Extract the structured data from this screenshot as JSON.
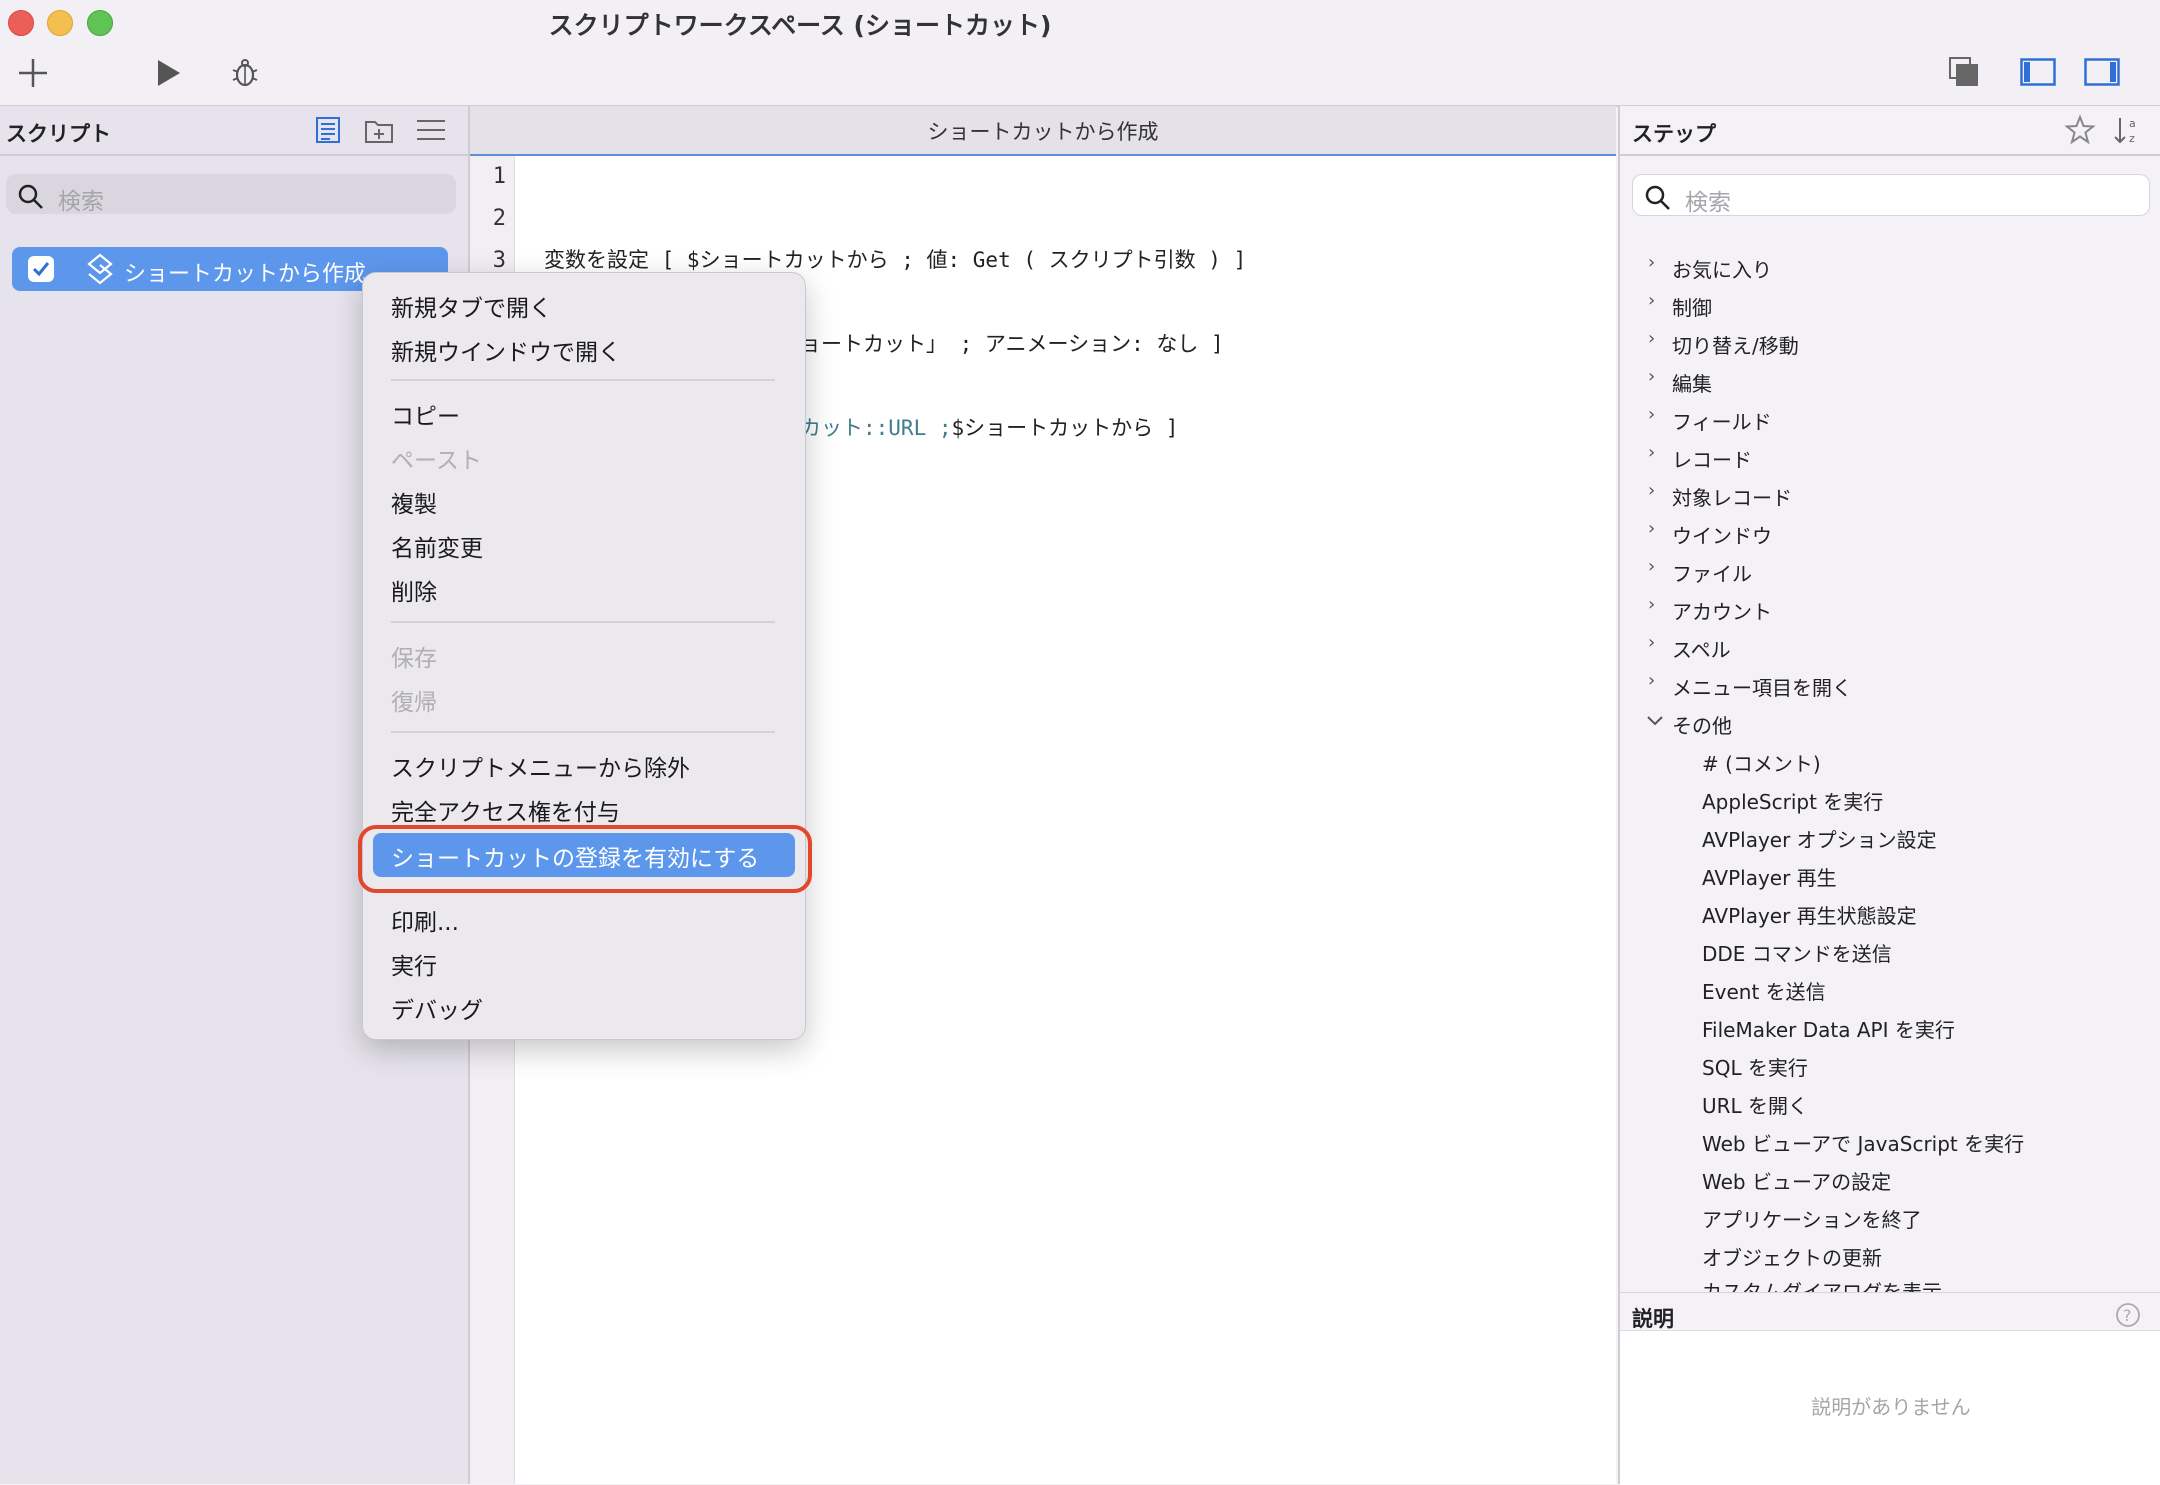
{
  "window": {
    "title": "スクリプトワークスペース (ショートカット)"
  },
  "sidebar": {
    "title": "スクリプト",
    "search_placeholder": "検索",
    "scripts": [
      {
        "label": "ショートカットから作成",
        "checked": true
      }
    ]
  },
  "editor": {
    "tab_title": "ショートカットから作成",
    "line_numbers": [
      "1",
      "2",
      "3"
    ],
    "lines": {
      "line3": "変数を設定 [ $ショートカットから ; 値: Get ( スクリプト引数 ) ]",
      "line5": "ョートカット」 ; アニメーション: なし ]",
      "line7_highlight": "カット::URL ;",
      "line7_rest": "$ショートカットから ]"
    }
  },
  "steps": {
    "title": "ステップ",
    "search_placeholder": "検索",
    "categories": [
      "お気に入り",
      "制御",
      "切り替え/移動",
      "編集",
      "フィールド",
      "レコード",
      "対象レコード",
      "ウインドウ",
      "ファイル",
      "アカウント",
      "スペル",
      "メニュー項目を開く"
    ],
    "expanded_category": "その他",
    "items": [
      "# (コメント)",
      "AppleScript を実行",
      "AVPlayer オプション設定",
      "AVPlayer 再生",
      "AVPlayer 再生状態設定",
      "DDE コマンドを送信",
      "Event を送信",
      "FileMaker Data API を実行",
      "SQL を実行",
      "URL を開く",
      "Web ビューアで JavaScript を実行",
      "Web ビューアの設定",
      "アプリケーションを終了",
      "オブジェクトの更新",
      "カスタムダイアログを表示"
    ],
    "description_title": "説明",
    "description_empty": "説明がありません"
  },
  "context_menu": {
    "open_new_tab": "新規タブで開く",
    "open_new_window": "新規ウインドウで開く",
    "copy": "コピー",
    "paste": "ペースト",
    "duplicate": "複製",
    "rename": "名前変更",
    "delete": "削除",
    "save": "保存",
    "revert": "復帰",
    "exclude_menu": "スクリプトメニューから除外",
    "grant_access": "完全アクセス権を付与",
    "enable_shortcut": "ショートカットの登録を有効にする",
    "print": "印刷...",
    "run": "実行",
    "debug": "デバッグ"
  },
  "colors": {
    "accent": "#5d97ec",
    "highlight_ring": "#e2472c"
  }
}
